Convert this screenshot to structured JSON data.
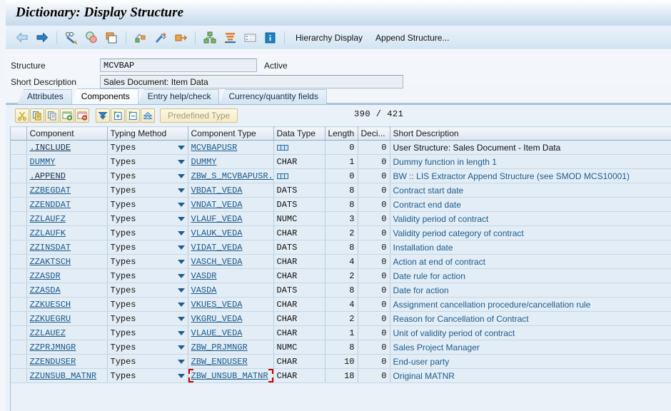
{
  "window": {
    "title": "Dictionary: Display Structure"
  },
  "toolbar": {
    "icons": [
      {
        "name": "back-icon",
        "label": "Back"
      },
      {
        "name": "forward-icon",
        "label": "Forward"
      },
      {
        "name": "display-change-icon",
        "label": "Display <-> Change"
      },
      {
        "name": "where-used-icon",
        "label": "Where-Used List"
      },
      {
        "name": "other-object-icon",
        "label": "Other object"
      },
      {
        "name": "check-icon",
        "label": "Check"
      },
      {
        "name": "activate-icon",
        "label": "Activate"
      },
      {
        "name": "expand-icon",
        "label": "Expand"
      },
      {
        "name": "hierarchy-icon",
        "label": "Hierarchy"
      },
      {
        "name": "stack-icon",
        "label": "Stack"
      },
      {
        "name": "table-view-icon",
        "label": "Table view"
      },
      {
        "name": "info-icon",
        "label": "Information"
      }
    ],
    "hierarchy_display_label": "Hierarchy Display",
    "append_structure_label": "Append Structure..."
  },
  "form": {
    "structure_label": "Structure",
    "structure_value": "MCVBAP",
    "status_label": "Active",
    "short_description_label": "Short Description",
    "short_description_value": "Sales Document: Item Data"
  },
  "tabs": [
    {
      "label": "Attributes",
      "active": false
    },
    {
      "label": "Components",
      "active": true
    },
    {
      "label": "Entry help/check",
      "active": false
    },
    {
      "label": "Currency/quantity fields",
      "active": false
    }
  ],
  "grid_toolbar": {
    "buttons": [
      {
        "name": "cut-button",
        "label": "Cut"
      },
      {
        "name": "copy-button",
        "label": "Copy"
      },
      {
        "name": "paste-button",
        "label": "Paste"
      },
      {
        "name": "insert-row-button",
        "label": "Insert Row"
      },
      {
        "name": "delete-row-button",
        "label": "Delete Row"
      },
      {
        "name": "srch-help-button",
        "label": "Search Help"
      },
      {
        "name": "insert-include-button",
        "label": "Insert Include"
      },
      {
        "name": "expand-include-button",
        "label": "Expand Include"
      },
      {
        "name": "collapse-include-button",
        "label": "Collapse Include"
      }
    ],
    "predefined_type_label": "Predefined Type",
    "counter": "390  /  421"
  },
  "table": {
    "columns": [
      {
        "key": "sel",
        "label": ""
      },
      {
        "key": "component",
        "label": "Component"
      },
      {
        "key": "typing_method",
        "label": "Typing Method"
      },
      {
        "key": "component_type",
        "label": "Component Type"
      },
      {
        "key": "data_type",
        "label": "Data Type"
      },
      {
        "key": "length",
        "label": "Length"
      },
      {
        "key": "decimals",
        "label": "Deci..."
      },
      {
        "key": "short_description",
        "label": "Short Description"
      }
    ],
    "rows": [
      {
        "component": ".INCLUDE",
        "component_style": "dark",
        "typing_method": "Types",
        "component_type": "MCVBAPUSR",
        "data_type": "",
        "data_type_icon": "structure-icon",
        "length": "0",
        "decimals": "0",
        "short_description": "User Structure: Sales Document - Item Data",
        "desc_style": "dark"
      },
      {
        "component": "DUMMY",
        "component_style": "link",
        "typing_method": "Types",
        "component_type": "DUMMY",
        "data_type": "CHAR",
        "length": "1",
        "decimals": "0",
        "short_description": "Dummy function in length 1",
        "desc_style": "blue"
      },
      {
        "component": ".APPEND",
        "component_style": "dark",
        "typing_method": "Types",
        "component_type": "ZBW_S_MCVBAPUSR...",
        "data_type": "",
        "data_type_icon": "structure-icon",
        "length": "0",
        "decimals": "0",
        "short_description": "BW :: LIS Extractor Append Structure (see SMOD MCS10001)",
        "desc_style": "blue"
      },
      {
        "component": "ZZBEGDAT",
        "component_style": "link",
        "typing_method": "Types",
        "component_type": "VBDAT_VEDA",
        "data_type": "DATS",
        "length": "8",
        "decimals": "0",
        "short_description": "Contract start date",
        "desc_style": "blue"
      },
      {
        "component": "ZZENDDAT",
        "component_style": "link",
        "typing_method": "Types",
        "component_type": "VNDAT_VEDA",
        "data_type": "DATS",
        "length": "8",
        "decimals": "0",
        "short_description": "Contract end date",
        "desc_style": "blue"
      },
      {
        "component": "ZZLAUFZ",
        "component_style": "link",
        "typing_method": "Types",
        "component_type": "VLAUF_VEDA",
        "data_type": "NUMC",
        "length": "3",
        "decimals": "0",
        "short_description": "Validity period of contract",
        "desc_style": "blue"
      },
      {
        "component": "ZZLAUFK",
        "component_style": "link",
        "typing_method": "Types",
        "component_type": "VLAUK_VEDA",
        "data_type": "CHAR",
        "length": "2",
        "decimals": "0",
        "short_description": "Validity period category of contract",
        "desc_style": "blue"
      },
      {
        "component": "ZZINSDAT",
        "component_style": "link",
        "typing_method": "Types",
        "component_type": "VIDAT_VEDA",
        "data_type": "DATS",
        "length": "8",
        "decimals": "0",
        "short_description": "Installation date",
        "desc_style": "blue"
      },
      {
        "component": "ZZAKTSCH",
        "component_style": "link",
        "typing_method": "Types",
        "component_type": "VASCH_VEDA",
        "data_type": "CHAR",
        "length": "4",
        "decimals": "0",
        "short_description": "Action at end of contract",
        "desc_style": "blue"
      },
      {
        "component": "ZZASDR",
        "component_style": "link",
        "typing_method": "Types",
        "component_type": "VASDR",
        "data_type": "CHAR",
        "length": "2",
        "decimals": "0",
        "short_description": "Date rule for action",
        "desc_style": "blue"
      },
      {
        "component": "ZZASDA",
        "component_style": "link",
        "typing_method": "Types",
        "component_type": "VASDA",
        "data_type": "DATS",
        "length": "8",
        "decimals": "0",
        "short_description": "Date for action",
        "desc_style": "blue"
      },
      {
        "component": "ZZKUESCH",
        "component_style": "link",
        "typing_method": "Types",
        "component_type": "VKUES_VEDA",
        "data_type": "CHAR",
        "length": "4",
        "decimals": "0",
        "short_description": "Assignment cancellation procedure/cancellation rule",
        "desc_style": "blue"
      },
      {
        "component": "ZZKUEGRU",
        "component_style": "link",
        "typing_method": "Types",
        "component_type": "VKGRU_VEDA",
        "data_type": "CHAR",
        "length": "2",
        "decimals": "0",
        "short_description": "Reason for Cancellation of Contract",
        "desc_style": "blue"
      },
      {
        "component": "ZZLAUEZ",
        "component_style": "link",
        "typing_method": "Types",
        "component_type": "VLAUE_VEDA",
        "data_type": "CHAR",
        "length": "1",
        "decimals": "0",
        "short_description": "Unit of validity period of contract",
        "desc_style": "blue"
      },
      {
        "component": "ZZPRJMNGR",
        "component_style": "link",
        "typing_method": "Types",
        "component_type": "ZBW_PRJMNGR",
        "data_type": "NUMC",
        "length": "8",
        "decimals": "0",
        "short_description": "Sales Project Manager",
        "desc_style": "blue"
      },
      {
        "component": "ZZENDUSER",
        "component_style": "link",
        "typing_method": "Types",
        "component_type": "ZBW_ENDUSER",
        "data_type": "CHAR",
        "length": "10",
        "decimals": "0",
        "short_description": "End-user party",
        "desc_style": "blue"
      },
      {
        "component": "ZZUNSUB_MATNR",
        "component_style": "link",
        "typing_method": "Types",
        "component_type": "ZBW_UNSUB_MATNR",
        "component_type_selected": true,
        "data_type": "CHAR",
        "length": "18",
        "decimals": "0",
        "short_description": "Original MATNR",
        "desc_style": "blue"
      }
    ]
  }
}
